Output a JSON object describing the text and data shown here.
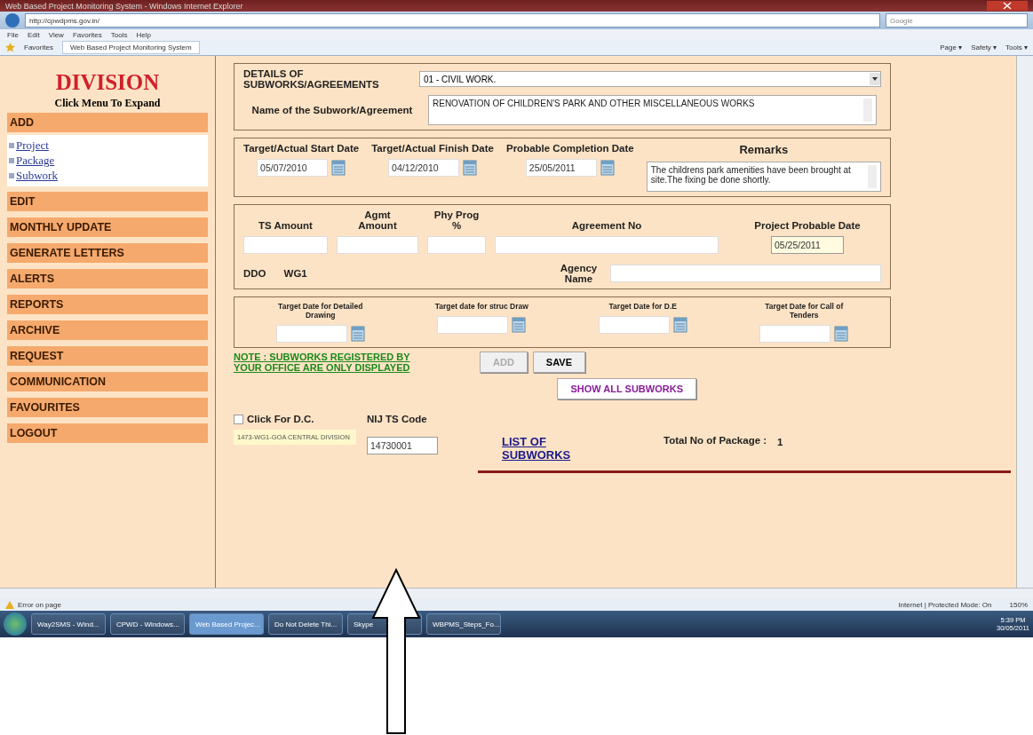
{
  "window": {
    "title": "Web Based Project Monitoring System - Windows Internet Explorer"
  },
  "browser": {
    "url": "http://cpwdpms.gov.in/",
    "search_placeholder": "Google",
    "menu": [
      "File",
      "Edit",
      "View",
      "Favorites",
      "Tools",
      "Help"
    ],
    "favorites_label": "Favorites",
    "tab_title": "Web Based Project Monitoring System",
    "tools": [
      "Page ▾",
      "Safety ▾",
      "Tools ▾"
    ]
  },
  "sidebar": {
    "title": "DIVISION",
    "subtitle": "Click Menu To Expand",
    "menu": [
      {
        "label": "ADD",
        "children": [
          {
            "label": "Project"
          },
          {
            "label": "Package"
          },
          {
            "label": "Subwork"
          }
        ]
      },
      {
        "label": "EDIT"
      },
      {
        "label": "MONTHLY UPDATE"
      },
      {
        "label": "GENERATE LETTERS"
      },
      {
        "label": "ALERTS"
      },
      {
        "label": "REPORTS"
      },
      {
        "label": "ARCHIVE"
      },
      {
        "label": "REQUEST"
      },
      {
        "label": "COMMUNICATION"
      },
      {
        "label": "FAVOURITES"
      },
      {
        "label": "LOGOUT"
      }
    ]
  },
  "form": {
    "heading": "DETAILS OF SUBWORKS/AGREEMENTS",
    "work_type": "01 - CIVIL WORK.",
    "name_label": "Name of the Subwork/Agreement",
    "name_value": "RENOVATION OF CHILDREN'S PARK AND OTHER MISCELLANEOUS WORKS",
    "dates": [
      {
        "label": "Target/Actual Start Date",
        "value": "05/07/2010"
      },
      {
        "label": "Target/Actual Finish Date",
        "value": "04/12/2010"
      },
      {
        "label": "Probable Completion Date",
        "value": "25/05/2011"
      }
    ],
    "remarks_label": "Remarks",
    "remarks_value": "The childrens park amenities have been brought at site.The fixing be done shortly.",
    "amounts": [
      {
        "label": "TS Amount"
      },
      {
        "label": "Agmt Amount"
      },
      {
        "label": "Phy Prog %"
      },
      {
        "label": "Agreement No"
      }
    ],
    "probable_label": "Project Probable Date",
    "probable_value": "05/25/2011",
    "ddo_label": "DDO",
    "ddo_value": "WG1",
    "agency_label": "Agency Name",
    "targets": [
      {
        "label": "Target Date for Detailed Drawing"
      },
      {
        "label": "Target date for struc Draw"
      },
      {
        "label": "Target Date for D.E"
      },
      {
        "label": "Target Date for Call of Tenders"
      }
    ],
    "note": "NOTE : SUBWORKS REGISTERED BY YOUR OFFICE ARE ONLY DISPLAYED",
    "buttons": [
      {
        "label": "ADD",
        "disabled": true
      },
      {
        "label": "SAVE",
        "disabled": false
      }
    ],
    "show_all": "SHOW ALL SUBWORKS",
    "dc": {
      "label": "Click For D.C.",
      "checked": false
    },
    "division": "1473-WG1-GOA CENTRAL DIVISION",
    "nij_label": "NIJ TS Code",
    "nij_value": "14730001",
    "list_link": "LIST OF SUBWORKS",
    "total_label": "Total No of Package :",
    "total_value": "1"
  },
  "status_bar": {
    "message": "Error on page",
    "zone": "Internet | Protected Mode: On",
    "zoom": "150%"
  },
  "taskbar": {
    "items": [
      {
        "label": "Way2SMS - Wind...",
        "selected": false
      },
      {
        "label": "CPWD - Windows...",
        "selected": false
      },
      {
        "label": "Web Based Projec...",
        "selected": true
      },
      {
        "label": "Do Not Delete Thi...",
        "selected": false
      },
      {
        "label": "Skype",
        "selected": false
      },
      {
        "label": "WBPMS_Steps_Fo...",
        "selected": false
      }
    ],
    "time": "5:39 PM",
    "date": "30/05/2011"
  }
}
